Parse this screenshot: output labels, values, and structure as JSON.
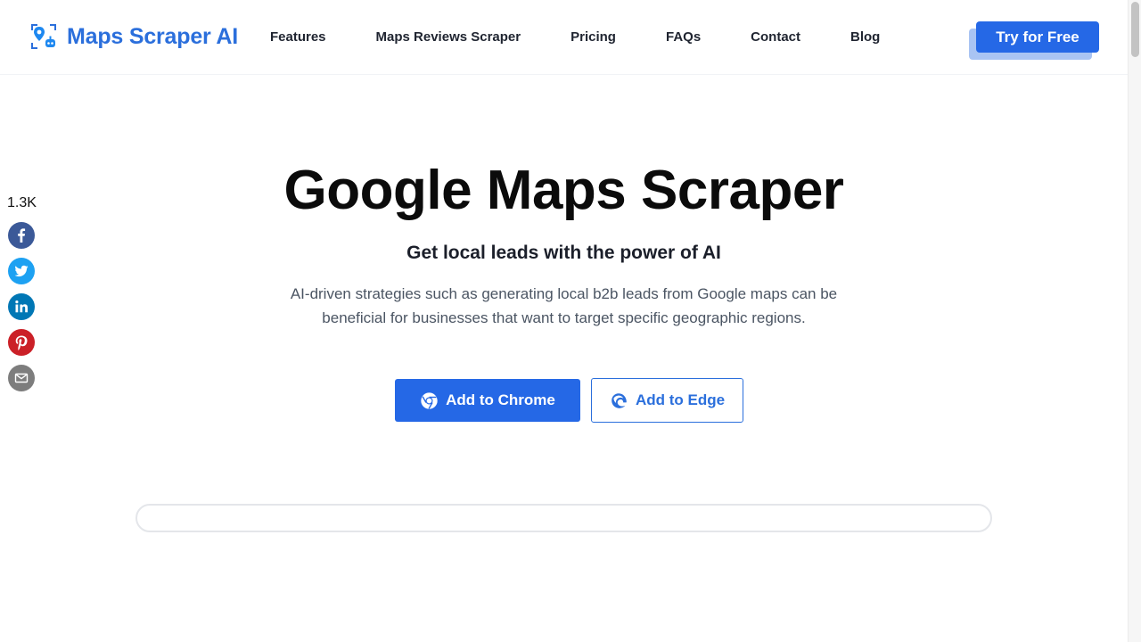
{
  "header": {
    "brand": "Maps Scraper AI",
    "nav": [
      {
        "label": "Features",
        "name": "nav-features"
      },
      {
        "label": "Maps Reviews Scraper",
        "name": "nav-maps-reviews-scraper"
      },
      {
        "label": "Pricing",
        "name": "nav-pricing"
      },
      {
        "label": "FAQs",
        "name": "nav-faqs"
      },
      {
        "label": "Contact",
        "name": "nav-contact"
      },
      {
        "label": "Blog",
        "name": "nav-blog"
      }
    ],
    "cta_label": "Try for Free"
  },
  "share": {
    "count": "1.3K",
    "buttons": [
      {
        "icon": "facebook-icon",
        "color": "#3b5998"
      },
      {
        "icon": "twitter-icon",
        "color": "#1da1f2"
      },
      {
        "icon": "linkedin-icon",
        "color": "#0077b5"
      },
      {
        "icon": "pinterest-icon",
        "color": "#cb2027"
      },
      {
        "icon": "email-icon",
        "color": "#7d7d7d"
      }
    ]
  },
  "hero": {
    "title": "Google Maps Scraper",
    "subtitle": "Get local leads with the power of AI",
    "description": "AI-driven strategies such as generating local b2b leads from Google maps can be beneficial for businesses that want to target specific geographic regions.",
    "chrome_button": "Add to Chrome",
    "edge_button": "Add to Edge"
  },
  "colors": {
    "brand": "#2b6fdc",
    "primary_button": "#2568e6"
  }
}
